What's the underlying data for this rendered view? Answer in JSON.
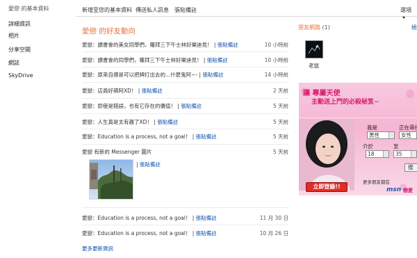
{
  "sidebar": {
    "title": "愛戀 的基本資料",
    "items": [
      "詳細資訊",
      "相片",
      "分享空間",
      "網誌",
      "SkyDrive"
    ]
  },
  "topnav": {
    "items": [
      "新增至您的基本資料",
      "傳送私人訊息",
      "張貼備註"
    ],
    "options": "選項"
  },
  "feed": {
    "title": "愛戀 的好友動向",
    "rows": [
      {
        "text": "愛戀：讀書會的美女同學們，蘿拜三下午士林好樂迪見！",
        "link": "張貼備註",
        "time": "10 小時前"
      },
      {
        "text": "愛戀：讀書會的同學們，蘿拜三下午士林好樂迪見！",
        "link": "張貼備註",
        "time": "10 小時前"
      },
      {
        "text": "愛戀：原來自摸是可以把牌打出去的...什麼鬼阿~-",
        "link": "張貼備註",
        "time": "14 小時前"
      },
      {
        "text": "愛戀：店員好萌阿XD！",
        "link": "張貼備註",
        "time": "2 天前"
      },
      {
        "text": "愛戀：即使是錯誤，也有它存在的價值！",
        "link": "張貼備註",
        "time": "5 天前"
      },
      {
        "text": "愛戀：人生真是太有趣了XD！",
        "link": "張貼備註",
        "time": "5 天前"
      },
      {
        "text": "愛戀：Education is a process, not a goal！",
        "link": "張貼備註",
        "time": "5 天前"
      },
      {
        "text": "愛戀 有新的 Messenger 圖片",
        "link": "",
        "time": "5 天前"
      }
    ],
    "photo_link": "張貼備註",
    "rows_after": [
      {
        "text": "愛戀：Education is a process, not a goal！",
        "link": "張貼備註",
        "time": "11 月 30 日"
      },
      {
        "text": "愛戀：Education is a process, not a goal！",
        "link": "張貼備註",
        "time": "10 月 26 日"
      }
    ],
    "more": "更多更新資訊"
  },
  "friends": {
    "title": "朋友網路",
    "count": "(1)",
    "overflow": "檢",
    "friend_name": "老鼠"
  },
  "ad": {
    "headline_1": "讓 專屬天使",
    "headline_2": "主動送上門的必殺秘笈~",
    "i_am_label": "我是",
    "seeking_label": "正在尋找",
    "i_am_value": "男性",
    "seeking_value": "女性",
    "age_label": "介於",
    "to_label": "至",
    "age_from": "18",
    "age_to": "35",
    "search_btn": "搜",
    "login_btn": "立即登錄!!",
    "more_friends": "更多朋友都在",
    "brand": "msn",
    "brand_suffix": "戀愛"
  },
  "colors": {
    "accent": "#e8743b",
    "link": "#0a4fa8"
  }
}
